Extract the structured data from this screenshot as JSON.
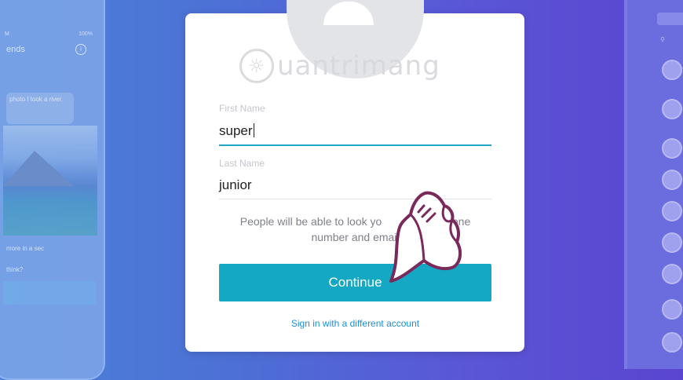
{
  "background": {
    "left_phone": {
      "status_left": "M",
      "status_right": "100%",
      "title": "ends",
      "info_icon": "i",
      "bubble1": "photo I took a river.",
      "bubble2": "more in a sec",
      "bubble3": "think?"
    },
    "right_phone": {
      "search_icon": "search-icon"
    }
  },
  "watermark": {
    "text": "uantrimang",
    "icon": "lightbulb-icon"
  },
  "form": {
    "first_name_label": "First Name",
    "first_name_value": "super",
    "last_name_label": "Last Name",
    "last_name_value": "junior",
    "info_line1": "People will be able to look yo",
    "info_line1_end": "phone",
    "info_line2": "number and email",
    "continue_label": "Continue",
    "signin_label": "Sign in with a different account"
  },
  "colors": {
    "accent": "#14a8c4",
    "link": "#1b8fd1",
    "active_underline": "#1fa6c6"
  },
  "icons": {
    "avatar": "user-avatar-icon",
    "hand": "pointing-hand-icon"
  }
}
